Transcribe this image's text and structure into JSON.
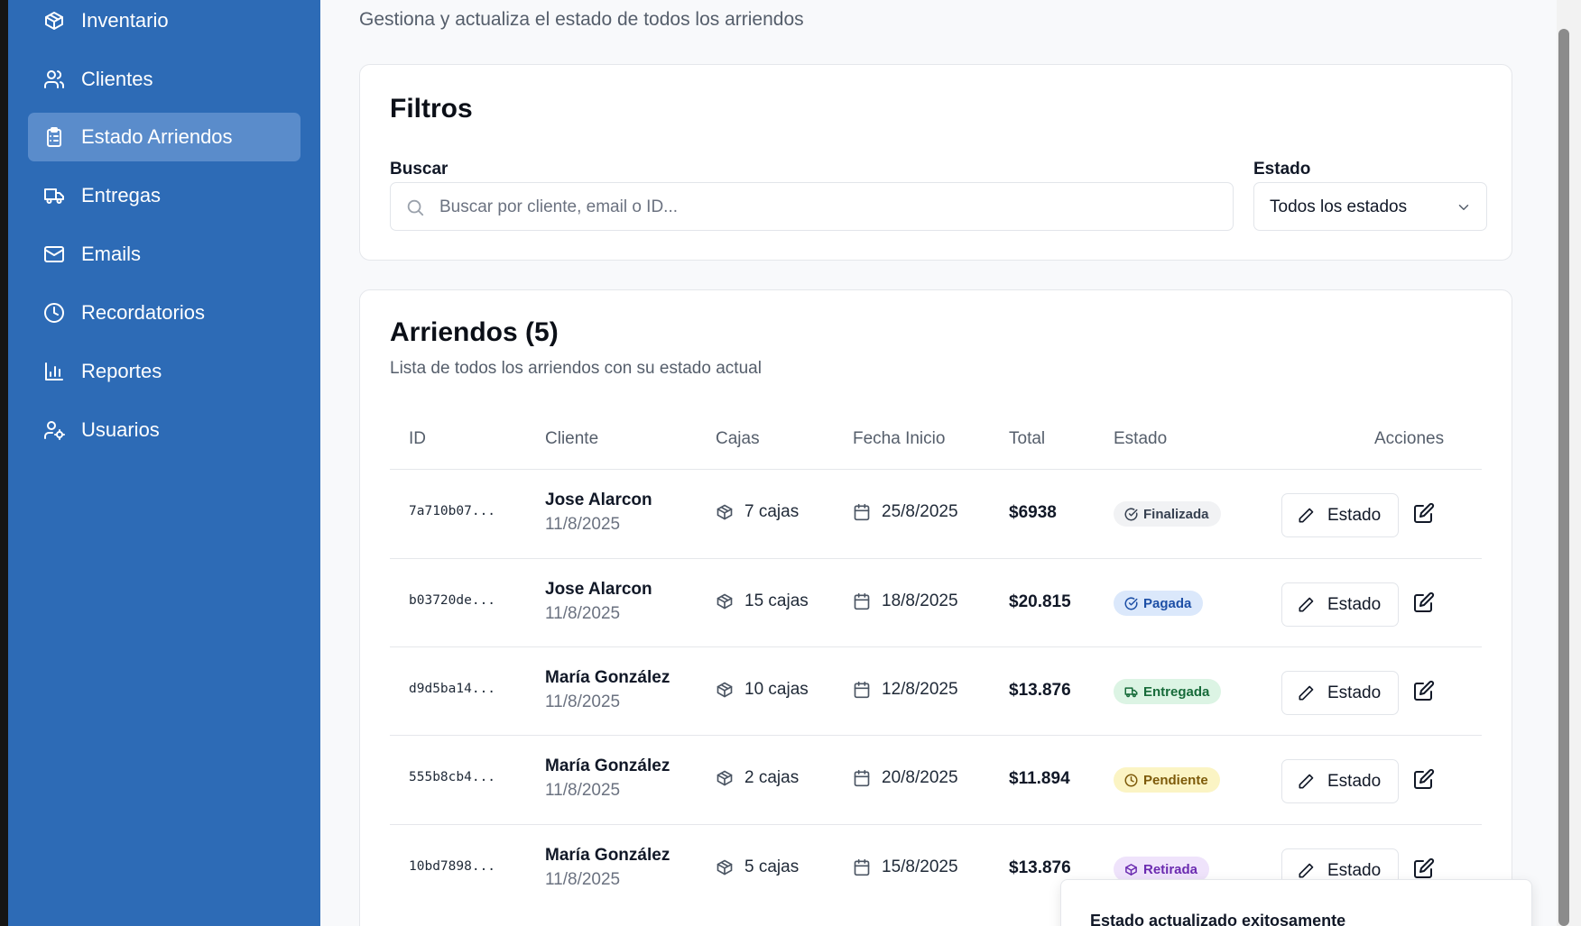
{
  "sidebar": {
    "items": [
      {
        "label": "Inventario",
        "icon": "package-icon",
        "active": false
      },
      {
        "label": "Clientes",
        "icon": "users-icon",
        "active": false
      },
      {
        "label": "Estado Arriendos",
        "icon": "clipboard-list-icon",
        "active": true
      },
      {
        "label": "Entregas",
        "icon": "truck-icon",
        "active": false
      },
      {
        "label": "Emails",
        "icon": "mail-icon",
        "active": false
      },
      {
        "label": "Recordatorios",
        "icon": "clock-icon",
        "active": false
      },
      {
        "label": "Reportes",
        "icon": "bar-chart-icon",
        "active": false
      },
      {
        "label": "Usuarios",
        "icon": "user-cog-icon",
        "active": false
      }
    ],
    "bg_color": "#2d6bb6",
    "active_color": "#5a8ccb"
  },
  "header": {
    "subtitle": "Gestiona y actualiza el estado de todos los arriendos"
  },
  "filters": {
    "title": "Filtros",
    "search_label": "Buscar",
    "search_placeholder": "Buscar por cliente, email o ID...",
    "search_value": "",
    "status_label": "Estado",
    "status_value": "Todos los estados"
  },
  "list": {
    "title": "Arriendos (5)",
    "description": "Lista de todos los arriendos con su estado actual",
    "columns": [
      "ID",
      "Cliente",
      "Cajas",
      "Fecha Inicio",
      "Total",
      "Estado",
      "Acciones"
    ],
    "rows": [
      {
        "id": "7a710b07...",
        "client": "Jose Alarcon",
        "created": "11/8/2025",
        "boxes": "7 cajas",
        "start": "25/8/2025",
        "total": "$6938",
        "status": "Finalizada",
        "status_icon": "check-circle-icon",
        "status_bg": "#f1f2f4",
        "status_fg": "#374151",
        "action_label": "Estado"
      },
      {
        "id": "b03720de...",
        "client": "Jose Alarcon",
        "created": "11/8/2025",
        "boxes": "15 cajas",
        "start": "18/8/2025",
        "total": "$20.815",
        "status": "Pagada",
        "status_icon": "check-circle-icon",
        "status_bg": "#dbe8fb",
        "status_fg": "#1d4fa6",
        "action_label": "Estado"
      },
      {
        "id": "d9d5ba14...",
        "client": "María González",
        "created": "11/8/2025",
        "boxes": "10 cajas",
        "start": "12/8/2025",
        "total": "$13.876",
        "status": "Entregada",
        "status_icon": "truck-icon",
        "status_bg": "#dcf4e4",
        "status_fg": "#176b3a",
        "action_label": "Estado"
      },
      {
        "id": "555b8cb4...",
        "client": "María González",
        "created": "11/8/2025",
        "boxes": "2 cajas",
        "start": "20/8/2025",
        "total": "$11.894",
        "status": "Pendiente",
        "status_icon": "clock-icon",
        "status_bg": "#fbf4c4",
        "status_fg": "#7d5a0a",
        "action_label": "Estado"
      },
      {
        "id": "10bd7898...",
        "client": "María González",
        "created": "11/8/2025",
        "boxes": "5 cajas",
        "start": "15/8/2025",
        "total": "$13.876",
        "status": "Retirada",
        "status_icon": "package-icon",
        "status_bg": "#efe3fb",
        "status_fg": "#6b2bb0",
        "action_label": "Estado"
      }
    ]
  },
  "toast": {
    "message": "Estado actualizado exitosamente"
  }
}
